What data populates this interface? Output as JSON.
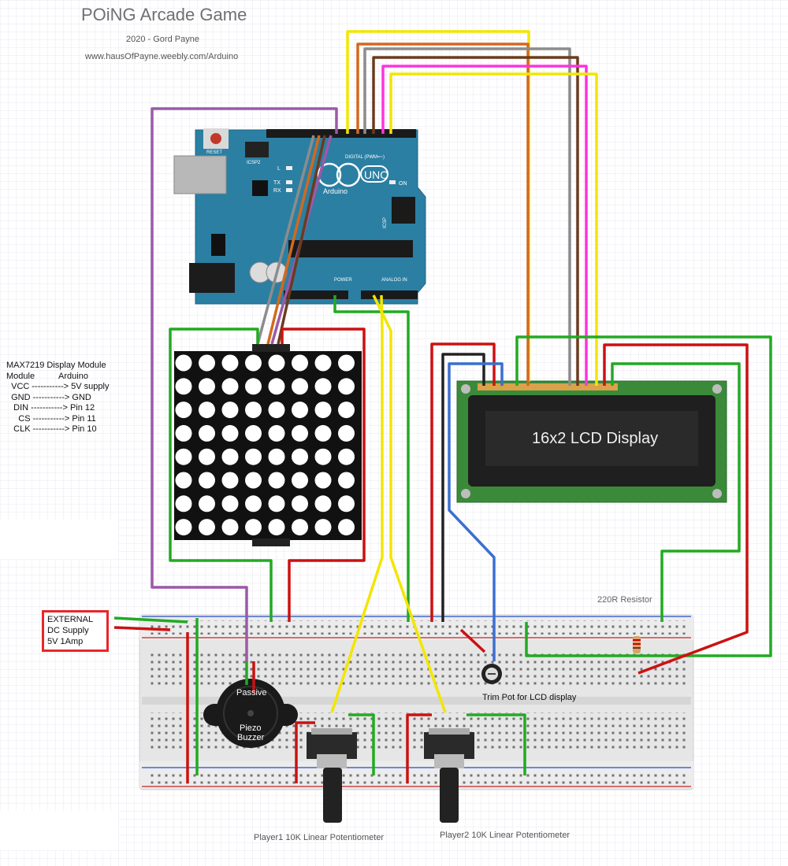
{
  "header": {
    "title": "POiNG Arcade Game",
    "credit": "2020 - Gord Payne",
    "url": "www.hausOfPayne.weebly.com/Arduino"
  },
  "legend": {
    "heading": "MAX7219 Display Module",
    "rows": [
      "Module          Arduino",
      "  VCC -----------> 5V supply",
      "  GND -----------> GND",
      "   DIN -----------> Pin 12",
      "     CS -----------> Pin 11",
      "   CLK -----------> Pin 10"
    ]
  },
  "external_supply": [
    "EXTERNAL",
    "DC Supply",
    "5V 1Amp"
  ],
  "arduino": {
    "brand": "UNO",
    "name": "Arduino",
    "reset": "RESET",
    "icsp2": "ICSP2",
    "icsp": "ICSP",
    "digital": "DIGITAL (PWM=~)",
    "power": "POWER",
    "analog": "ANALOG IN",
    "led_l": "L",
    "led_tx": "TX",
    "led_rx": "RX",
    "led_on": "ON"
  },
  "lcd": {
    "text": "16x2 LCD Display"
  },
  "resistor": {
    "label": "220R Resistor"
  },
  "trimpot": {
    "label": "Trim Pot for LCD display"
  },
  "buzzer": {
    "line1": "Passive",
    "line2": "Piezo",
    "line3": "Buzzer"
  },
  "pot1": {
    "label": "Player1 10K Linear Potentiometer"
  },
  "pot2": {
    "label": "Player2 10K Linear Potentiometer"
  },
  "colors": {
    "board": "#2b7fa3",
    "lcd_pcb": "#3a8a3a",
    "breadboard": "#e6e6e6",
    "wire_red": "#cc1111",
    "wire_green": "#22aa22",
    "wire_yellow": "#f2e600",
    "wire_purple": "#9b59a8",
    "wire_blue": "#3b6fd0",
    "wire_orange": "#d2691e",
    "wire_brown": "#6b3b1f",
    "wire_grey": "#8c8c8c",
    "wire_magenta": "#ff33dd",
    "wire_black": "#222222"
  }
}
